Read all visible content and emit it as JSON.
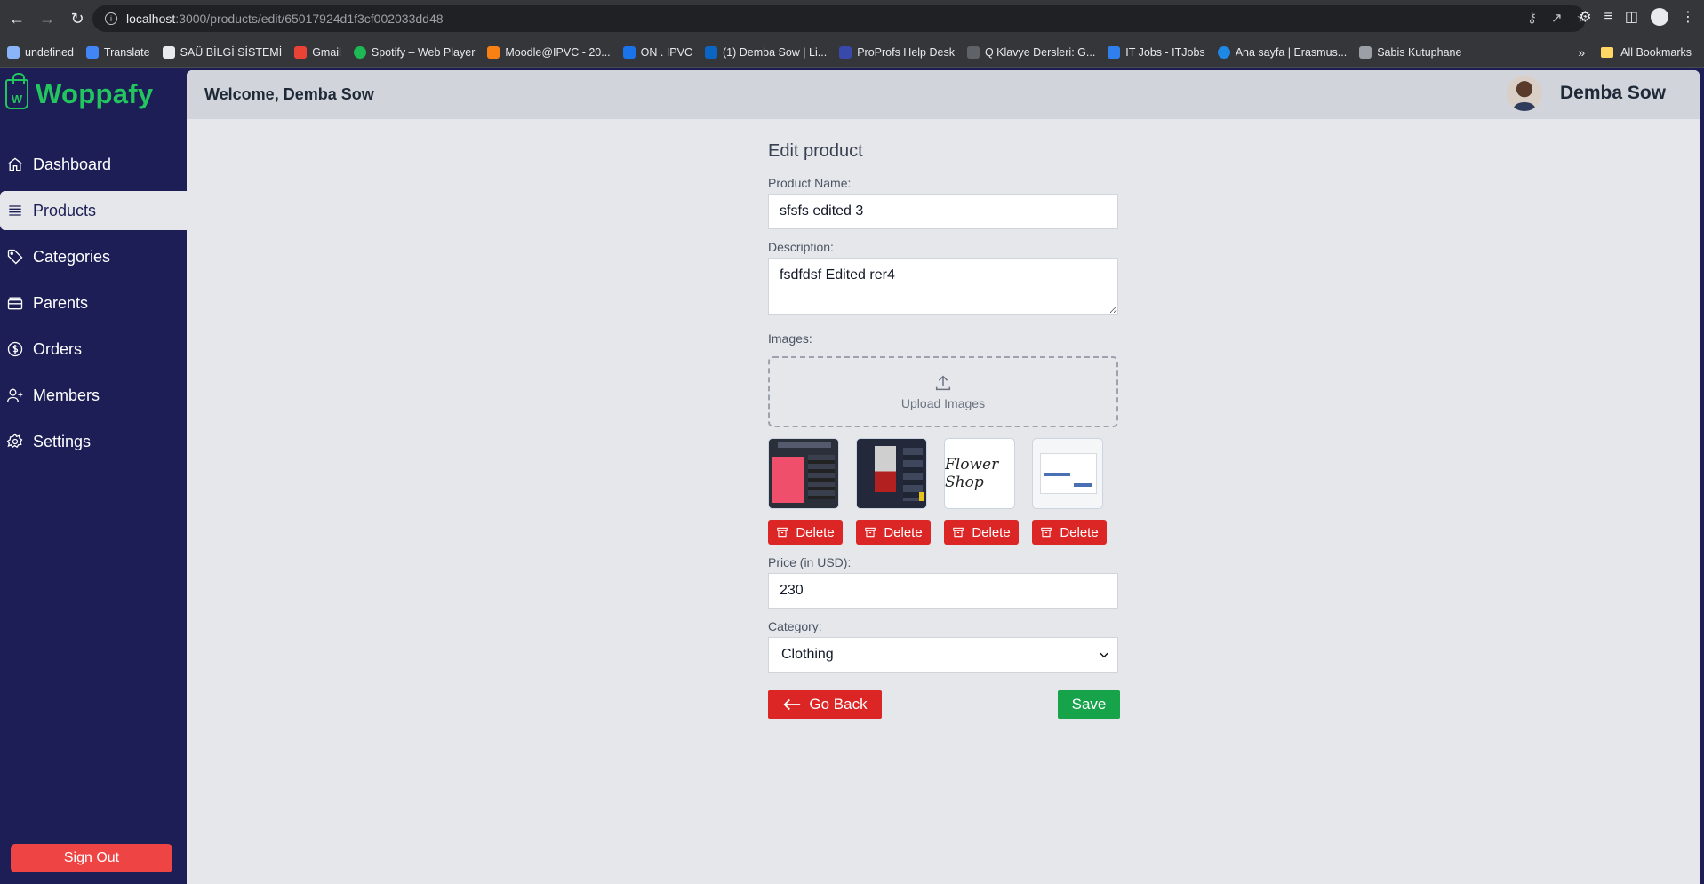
{
  "browser": {
    "url_host": "localhost",
    "url_path": ":3000/products/edit/65017924d1f3cf002033dd48",
    "bookmarks": [
      {
        "label": "undefined",
        "color": "#8ab4f8"
      },
      {
        "label": "Translate",
        "color": "#4285f4"
      },
      {
        "label": "SAÜ BİLGİ SİSTEMİ",
        "color": "#e8eaed"
      },
      {
        "label": "Gmail",
        "color": "#ea4335"
      },
      {
        "label": "Spotify – Web Player",
        "color": "#1db954"
      },
      {
        "label": "Moodle@IPVC - 20...",
        "color": "#f98012"
      },
      {
        "label": "ON . IPVC",
        "color": "#1a73e8"
      },
      {
        "label": "(1) Demba Sow | Li...",
        "color": "#0a66c2"
      },
      {
        "label": "ProProfs Help Desk",
        "color": "#3949ab"
      },
      {
        "label": "Q Klavye Dersleri: G...",
        "color": "#5f6368"
      },
      {
        "label": "IT Jobs - ITJobs",
        "color": "#2f80ed"
      },
      {
        "label": "Ana sayfa | Erasmus...",
        "color": "#1e88e5"
      },
      {
        "label": "Sabis Kutuphane",
        "color": "#9aa0a6"
      }
    ],
    "all_bookmarks": "All Bookmarks"
  },
  "brand": {
    "name": "Woppafy",
    "logo_letter": "W",
    "color": "#22c55e"
  },
  "sidebar": {
    "items": [
      {
        "label": "Dashboard",
        "icon": "home-icon"
      },
      {
        "label": "Products",
        "icon": "list-icon"
      },
      {
        "label": "Categories",
        "icon": "tag-icon"
      },
      {
        "label": "Parents",
        "icon": "archive-icon"
      },
      {
        "label": "Orders",
        "icon": "dollar-icon"
      },
      {
        "label": "Members",
        "icon": "user-plus-icon"
      },
      {
        "label": "Settings",
        "icon": "gear-icon"
      }
    ],
    "active": "Products",
    "sign_out": "Sign Out"
  },
  "header": {
    "welcome": "Welcome, Demba Sow",
    "user_name": "Demba Sow"
  },
  "form": {
    "title": "Edit product",
    "name_label": "Product Name:",
    "name_value": "sfsfs edited 3",
    "description_label": "Description:",
    "description_value": "fsdfdsf Edited rer4",
    "images_label": "Images:",
    "upload_label": "Upload Images",
    "delete_label": "Delete",
    "price_label": "Price (in USD):",
    "price_value": "230",
    "category_label": "Category:",
    "category_value": "Clothing",
    "back_label": "Go Back",
    "save_label": "Save",
    "thumbnail_3_text": "Flower Shop"
  },
  "colors": {
    "sidebar": "#1c1e55",
    "danger": "#dc2626",
    "success": "#16a34a",
    "signout": "#ef4444"
  }
}
